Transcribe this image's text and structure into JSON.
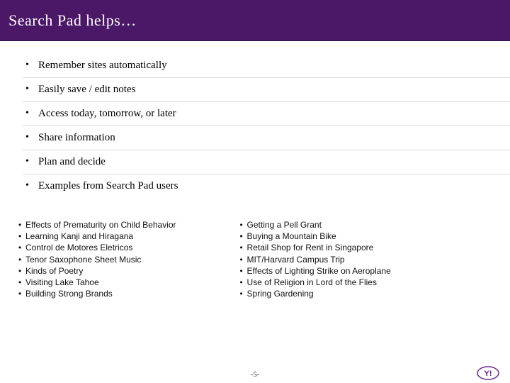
{
  "title": "Search Pad helps…",
  "mainBullets": [
    "Remember sites automatically",
    "Easily save / edit notes",
    "Access today, tomorrow, or later",
    "Share information",
    "Plan and decide",
    "Examples from Search Pad users"
  ],
  "examplesLeft": [
    "Effects of Prematurity on Child Behavior",
    "Learning Kanji and Hiragana",
    "Control de Motores Eletricos",
    "Tenor Saxophone Sheet Music",
    "Kinds of Poetry",
    "Visiting Lake Tahoe",
    "Building Strong Brands"
  ],
  "examplesRight": [
    "Getting a Pell Grant",
    "Buying a Mountain Bike",
    "Retail Shop for Rent in Singapore",
    "MIT/Harvard Campus Trip",
    "Effects of Lighting Strike on Aeroplane",
    "Use of Religion in Lord of the Flies",
    "Spring Gardening"
  ],
  "pageNumber": "-5-",
  "logoLabel": "Yahoo logo"
}
